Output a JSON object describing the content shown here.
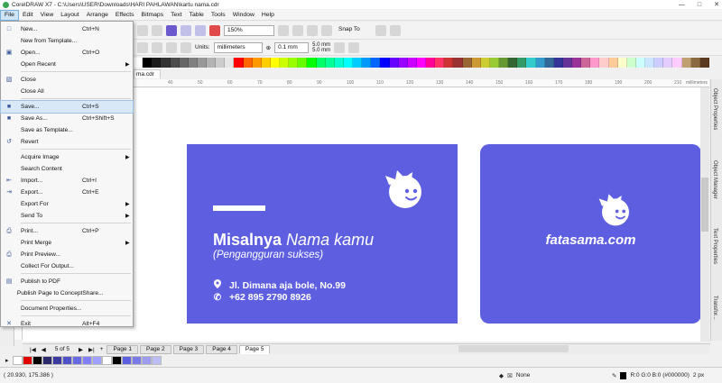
{
  "window": {
    "title": "CorelDRAW X7 - C:\\Users\\USER\\Downloads\\HARI PAHLAWAN\\kartu nama.cdr"
  },
  "menubar": [
    "File",
    "Edit",
    "View",
    "Layout",
    "Arrange",
    "Effects",
    "Bitmaps",
    "Text",
    "Table",
    "Tools",
    "Window",
    "Help"
  ],
  "toolbar": {
    "zoom": "150%",
    "snap": "Snap To"
  },
  "propbar": {
    "units_label": "Units:",
    "units_value": "millimeters",
    "nudge": "0.1 mm",
    "dup_x": "5.0 mm",
    "dup_y": "5.0 mm"
  },
  "document_tab": "ma.cdr",
  "ruler": {
    "ticks": [
      "40",
      "50",
      "60",
      "70",
      "80",
      "90",
      "100",
      "110",
      "120",
      "130",
      "140",
      "150",
      "160",
      "170",
      "180",
      "190",
      "200",
      "210"
    ],
    "unit": "millimeters"
  },
  "file_menu": [
    {
      "label": "New...",
      "shortcut": "Ctrl+N",
      "icon": "new-icon"
    },
    {
      "label": "New from Template...",
      "shortcut": "",
      "icon": ""
    },
    {
      "label": "Open...",
      "shortcut": "Ctrl+O",
      "icon": "open-icon"
    },
    {
      "label": "Open Recent",
      "shortcut": "",
      "icon": "",
      "submenu": true
    },
    {
      "label": "Close",
      "shortcut": "",
      "icon": "close-doc-icon",
      "sep_before": true
    },
    {
      "label": "Close All",
      "shortcut": "",
      "icon": ""
    },
    {
      "label": "Save...",
      "shortcut": "Ctrl+S",
      "icon": "save-icon",
      "sep_before": true,
      "highlight": true
    },
    {
      "label": "Save As...",
      "shortcut": "Ctrl+Shift+S",
      "icon": "save-as-icon"
    },
    {
      "label": "Save as Template...",
      "shortcut": "",
      "icon": ""
    },
    {
      "label": "Revert",
      "shortcut": "",
      "icon": "revert-icon"
    },
    {
      "label": "Acquire Image",
      "shortcut": "",
      "icon": "",
      "submenu": true,
      "sep_before": true
    },
    {
      "label": "Search Content",
      "shortcut": "",
      "icon": ""
    },
    {
      "label": "Import...",
      "shortcut": "Ctrl+I",
      "icon": "import-icon"
    },
    {
      "label": "Export...",
      "shortcut": "Ctrl+E",
      "icon": "export-icon"
    },
    {
      "label": "Export For",
      "shortcut": "",
      "icon": "",
      "submenu": true
    },
    {
      "label": "Send To",
      "shortcut": "",
      "icon": "",
      "submenu": true
    },
    {
      "label": "Print...",
      "shortcut": "Ctrl+P",
      "icon": "print-icon",
      "sep_before": true
    },
    {
      "label": "Print Merge",
      "shortcut": "",
      "icon": "",
      "submenu": true
    },
    {
      "label": "Print Preview...",
      "shortcut": "",
      "icon": "print-preview-icon"
    },
    {
      "label": "Collect For Output...",
      "shortcut": "",
      "icon": ""
    },
    {
      "label": "Publish to PDF",
      "shortcut": "",
      "icon": "pdf-icon",
      "sep_before": true
    },
    {
      "label": "Publish Page to ConceptShare...",
      "shortcut": "",
      "icon": ""
    },
    {
      "label": "Document Properties...",
      "shortcut": "",
      "icon": "",
      "sep_before": true
    },
    {
      "label": "Exit",
      "shortcut": "Alt+F4",
      "icon": "exit-icon",
      "sep_before": true
    }
  ],
  "card_front": {
    "name_bold": "Misalnya",
    "name_italic": "Nama kamu",
    "subtitle": "(Pengangguran sukses)",
    "address": "Jl. Dimana aja bole, No.99",
    "phone": "+62 895 2790 8926"
  },
  "card_back": {
    "brand": "fatasama.com"
  },
  "card_color": "#5e5fe0",
  "dockers": [
    "Object Properties",
    "Object Manager",
    "Text Properties",
    "Transfor..."
  ],
  "pages": {
    "counter": "5 of 5",
    "tabs": [
      "Page 1",
      "Page 2",
      "Page 3",
      "Page 4",
      "Page 5"
    ],
    "active": 4
  },
  "status": {
    "coords": "( 20.930, 175.386 )",
    "fill": "None",
    "outline": "R:0 G:0 B:0 (#000000)",
    "outline_width": "2 px"
  },
  "palette_colors": [
    "#ffffff",
    "#000000",
    "#1a1a1a",
    "#333333",
    "#4d4d4d",
    "#666666",
    "#808080",
    "#999999",
    "#b3b3b3",
    "#cccccc",
    "#e6e6e6",
    "#ff0000",
    "#ff6600",
    "#ff9900",
    "#ffcc00",
    "#ffff00",
    "#ccff00",
    "#99ff00",
    "#66ff00",
    "#00ff00",
    "#00ff66",
    "#00ff99",
    "#00ffcc",
    "#00ffff",
    "#00ccff",
    "#0099ff",
    "#0066ff",
    "#0000ff",
    "#6600ff",
    "#9900ff",
    "#cc00ff",
    "#ff00ff",
    "#ff0099",
    "#ff3366",
    "#cc3333",
    "#993333",
    "#996633",
    "#cc9933",
    "#cccc33",
    "#99cc33",
    "#669933",
    "#336633",
    "#339966",
    "#33cccc",
    "#3399cc",
    "#336699",
    "#333399",
    "#663399",
    "#993399",
    "#cc6699",
    "#ff99cc",
    "#ffcccc",
    "#ffcc99",
    "#ffffcc",
    "#ccffcc",
    "#ccffff",
    "#cce5ff",
    "#ccccff",
    "#e5ccff",
    "#ffccff",
    "#c0a070",
    "#8a6a40",
    "#5a3a20"
  ],
  "doc_palette_colors": [
    "#ffffff",
    "#e00000",
    "#000000",
    "#2a2a6a",
    "#3a3aa0",
    "#5050c8",
    "#6a6ae0",
    "#8080ff",
    "#a0a0ff",
    "#ffffff",
    "#000000",
    "#5e5fe0",
    "#7a7ae8",
    "#9c9cf0",
    "#bebef7"
  ]
}
